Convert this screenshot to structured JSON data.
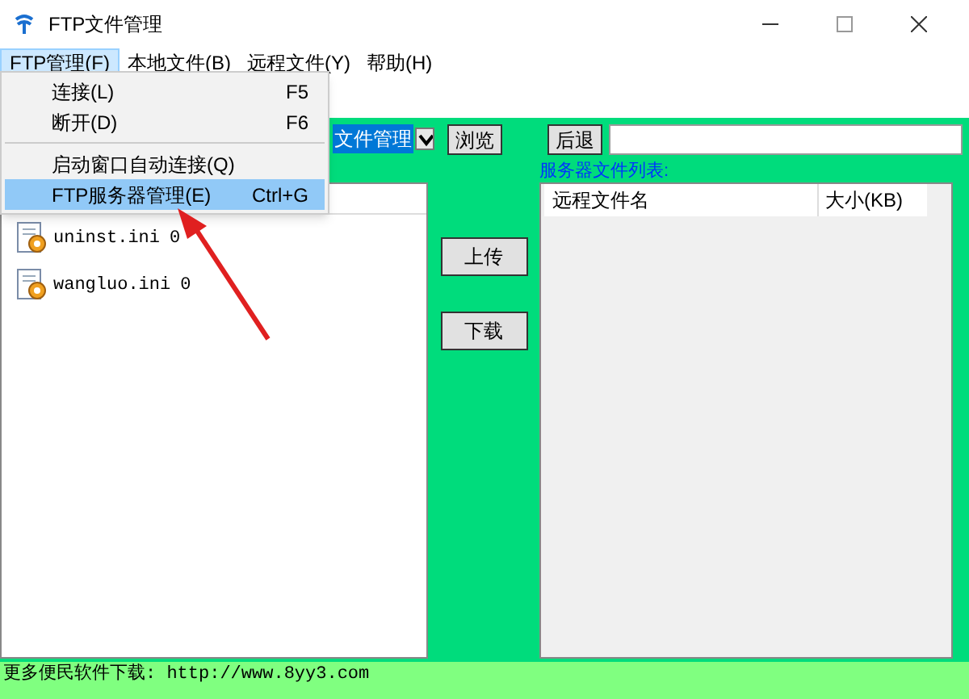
{
  "window": {
    "title": "FTP文件管理"
  },
  "menu_bar": [
    {
      "label": "FTP管理(F)",
      "selected": true
    },
    {
      "label": "本地文件(B)",
      "selected": false
    },
    {
      "label": "远程文件(Y)",
      "selected": false
    },
    {
      "label": "帮助(H)",
      "selected": false
    }
  ],
  "dropdown_menu": [
    {
      "label": "连接(L)",
      "shortcut": "F5",
      "selected": false,
      "separator_after": false
    },
    {
      "label": "断开(D)",
      "shortcut": "F6",
      "selected": false,
      "separator_after": true
    },
    {
      "label": "启动窗口自动连接(Q)",
      "selected": false,
      "separator_after": false
    },
    {
      "label": "FTP服务器管理(E)",
      "shortcut": "Ctrl+G",
      "selected": true,
      "separator_after": false
    }
  ],
  "local": {
    "path_value": "文件管理",
    "browse_button": "浏览",
    "files": [
      {
        "name": "uninst.ini",
        "size": "0"
      },
      {
        "name": "wangluo.ini",
        "size": "0"
      }
    ]
  },
  "transfer_buttons": [
    "上传",
    "下载"
  ],
  "remote": {
    "back_button": "后退",
    "list_label": "服务器文件列表:",
    "columns": [
      "远程文件名",
      "大小(KB)"
    ]
  },
  "status_bar": "更多便民软件下载: http://www.8yy3.com"
}
